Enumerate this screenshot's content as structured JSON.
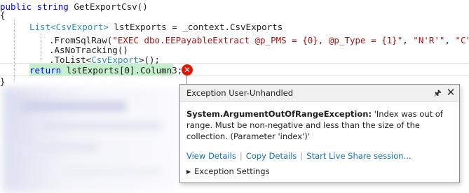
{
  "code": {
    "line1": {
      "kw": "public string",
      "rest": " GetExportCsv()"
    },
    "line2": "{",
    "line3": {
      "type1": "List<CsvExport>",
      "rest": " lstExports = _context.CsvExports"
    },
    "line4": {
      "method": ".FromSqlRaw(",
      "str1": "\"EXEC dbo.EEPayableExtract @p_PMS = {0}, @p_Type = {1}\"",
      "sep1": ", ",
      "str2": "\"N'R'\"",
      "sep2": ", ",
      "str3": "\"C\"",
      "end": ")"
    },
    "line5": ".AsNoTracking()",
    "line6": {
      "method": ".ToList<",
      "type": "CsvExport",
      "end": ">();"
    },
    "line7": {
      "kw": "return",
      "rest": " lstExports[0].Column3;"
    },
    "line8": "}"
  },
  "error_glyph": "✕",
  "exception_popup": {
    "title": "Exception User-Unhandled",
    "exception_type": "System.ArgumentOutOfRangeException:",
    "message": " 'Index was out of range. Must be non-negative and less than the size of the collection. (Parameter 'index')'",
    "links": {
      "view_details": "View Details",
      "copy_details": "Copy Details",
      "live_share": "Start Live Share session..."
    },
    "separator": "|",
    "settings_label": "Exception Settings",
    "pin_icon": "pin-icon",
    "close_icon": "close-icon"
  },
  "colors": {
    "keyword": "#0000ff",
    "type": "#2b91af",
    "string": "#a31515",
    "highlight": "#c6efce",
    "error": "#e51400",
    "link": "#0e70c0"
  }
}
